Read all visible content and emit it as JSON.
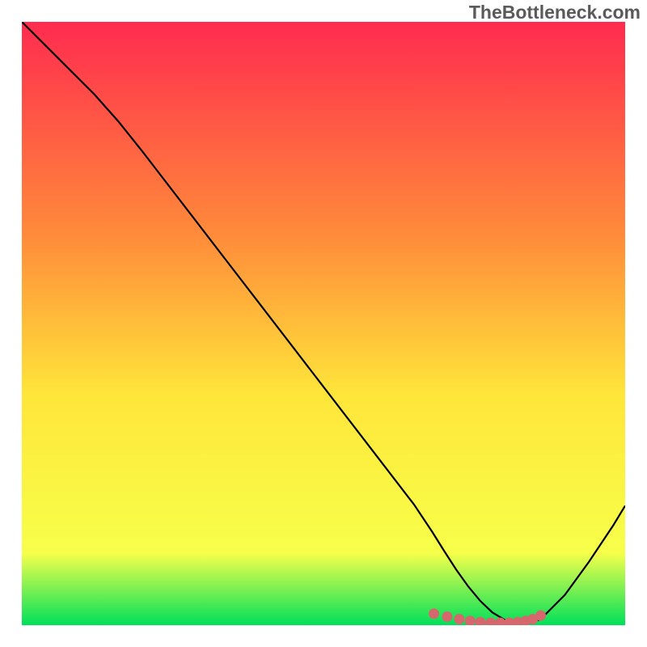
{
  "watermark": "TheBottleneck.com",
  "chart_data": {
    "type": "line",
    "title": "",
    "xlabel": "",
    "ylabel": "",
    "xlim": [
      0,
      100
    ],
    "ylim": [
      0,
      100
    ],
    "gradient": {
      "top": "#ff2b4f",
      "mid_upper": "#ff8a3a",
      "mid": "#ffe63a",
      "mid_lower": "#f7ff4a",
      "bottom": "#00e05a"
    },
    "curve_color": "#000000",
    "marker_color": "#d5676d",
    "series": [
      {
        "name": "bottleneck-curve",
        "x": [
          0,
          4,
          8,
          12,
          16,
          20,
          25,
          30,
          35,
          40,
          45,
          50,
          55,
          60,
          65,
          68,
          70,
          72,
          74,
          76,
          78,
          80,
          82,
          84,
          86,
          90,
          94,
          98,
          100
        ],
        "y": [
          100,
          96,
          92,
          88,
          83.5,
          78.5,
          72,
          65.5,
          59,
          52.5,
          46,
          39.5,
          33,
          26.5,
          20,
          15.5,
          12.3,
          9.2,
          6.4,
          4.0,
          2.1,
          0.9,
          0.3,
          0.3,
          1.0,
          5.0,
          10.5,
          16.5,
          19.8
        ]
      }
    ],
    "markers": {
      "name": "bottom-markers",
      "x": [
        68.3,
        70.5,
        72.5,
        74.3,
        76.0,
        77.7,
        79.3,
        80.8,
        82.2,
        83.5,
        84.7,
        86.0
      ],
      "y": [
        1.9,
        1.4,
        1.0,
        0.7,
        0.5,
        0.4,
        0.4,
        0.4,
        0.5,
        0.7,
        1.0,
        1.6
      ]
    }
  }
}
